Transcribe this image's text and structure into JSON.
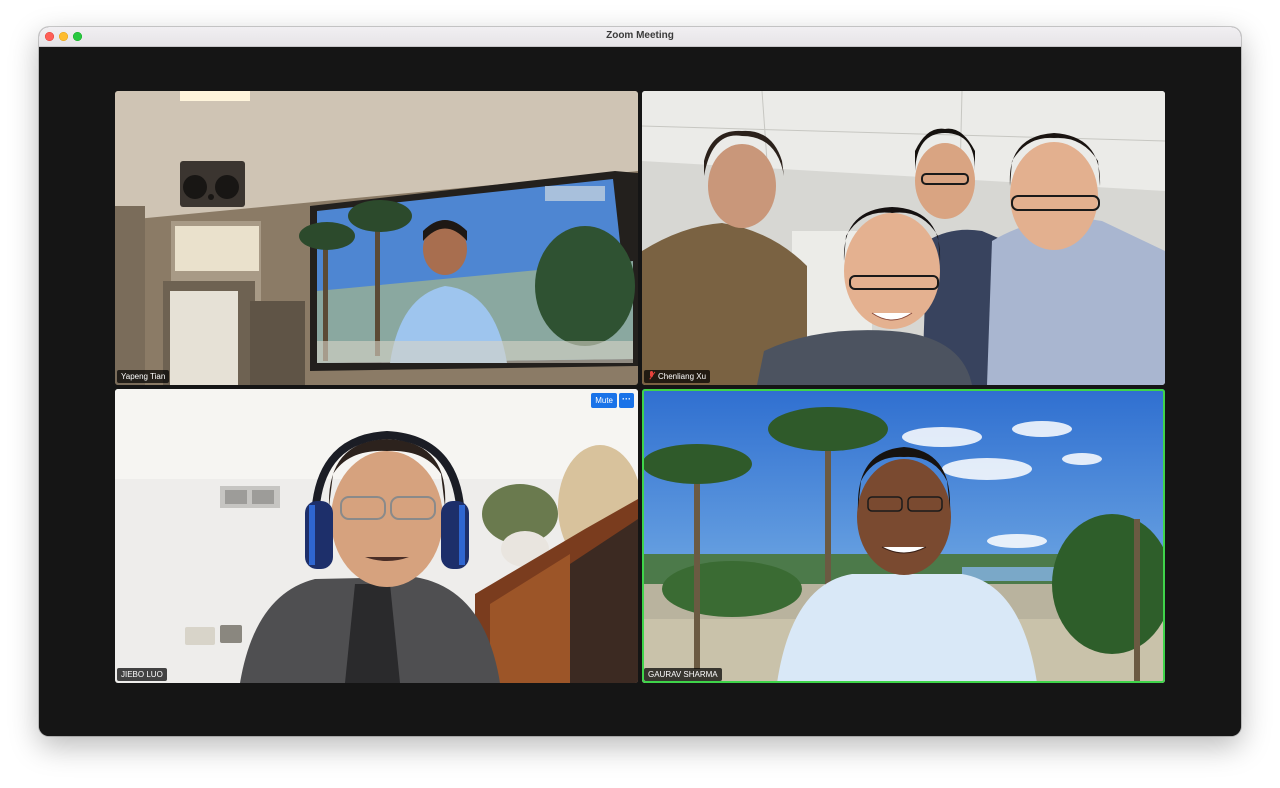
{
  "window": {
    "title": "Zoom Meeting"
  },
  "participants": [
    {
      "name": "Yapeng Tian",
      "mic_muted": false
    },
    {
      "name": "Chenliang Xu",
      "mic_muted": true
    },
    {
      "name": "JIEBO LUO",
      "mic_muted": false
    },
    {
      "name": "GAURAV SHARMA",
      "mic_muted": false,
      "active_speaker": true
    }
  ],
  "tile_controls": {
    "mute_label": "Mute",
    "more_label": "···"
  },
  "colors": {
    "active_speaker_border": "#3fd44a",
    "button_blue": "#1a73e8",
    "muted_mic": "#e8433c"
  }
}
